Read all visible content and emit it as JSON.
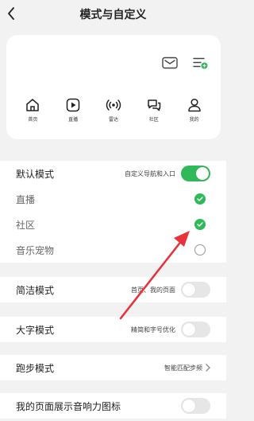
{
  "header": {
    "title": "模式与自定义"
  },
  "preview": {
    "nav": [
      {
        "label": "首页"
      },
      {
        "label": "直播"
      },
      {
        "label": "雷达"
      },
      {
        "label": "社区"
      },
      {
        "label": "我的"
      }
    ]
  },
  "default_mode": {
    "label": "默认模式",
    "hint": "自定义导航和入口",
    "toggle_on": true,
    "options": [
      {
        "label": "直播",
        "checked": true
      },
      {
        "label": "社区",
        "checked": true
      },
      {
        "label": "音乐宠物",
        "checked": false
      }
    ]
  },
  "simple_mode": {
    "label": "简洁模式",
    "hint": "首页、我的页面",
    "toggle_on": false
  },
  "large_font_mode": {
    "label": "大字模式",
    "hint": "精简和字号优化",
    "toggle_on": false
  },
  "running_mode": {
    "label": "跑步模式",
    "hint": "智能匹配步频"
  },
  "my_page_sound_icon": {
    "label": "我的页面展示音响力图标",
    "toggle_on": false
  },
  "colors": {
    "accent": "#2fb95a",
    "annotation_arrow": "#e8323c"
  }
}
